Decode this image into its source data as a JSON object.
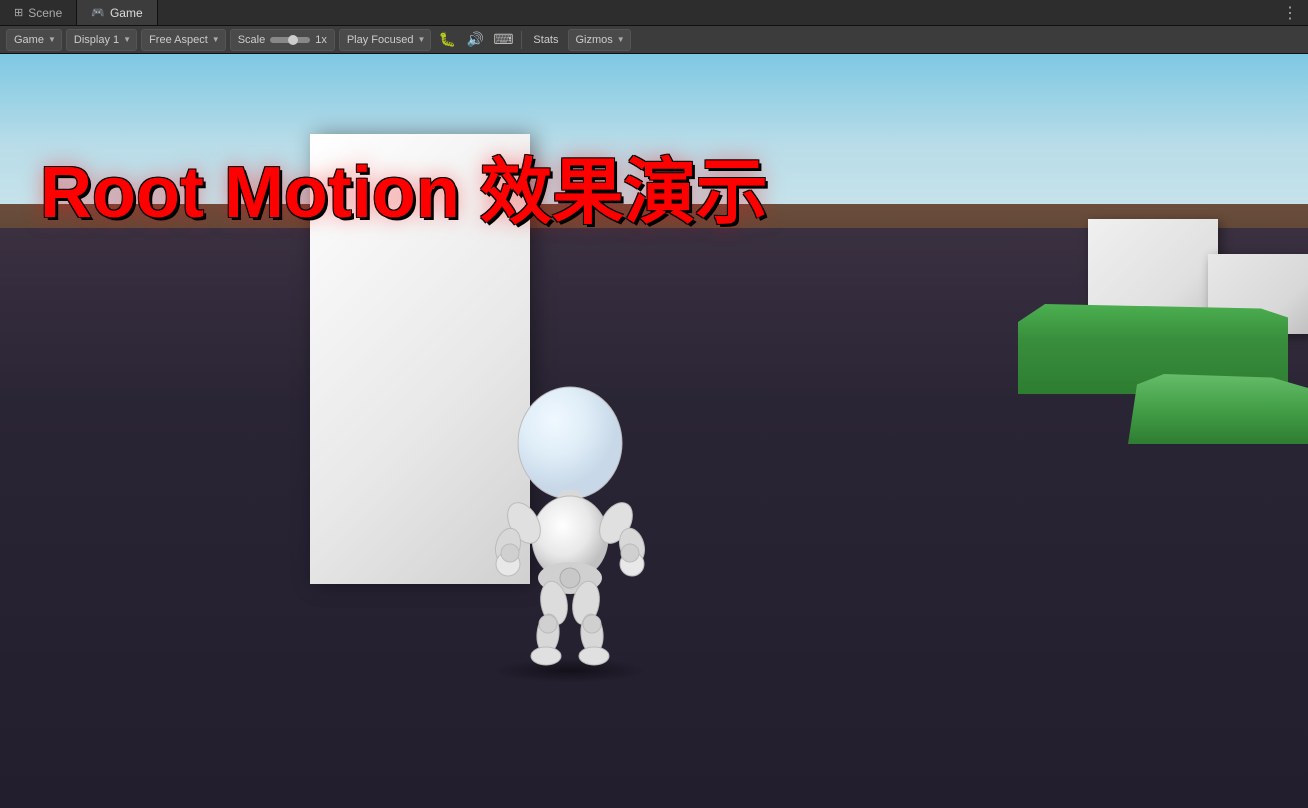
{
  "tabs": [
    {
      "id": "scene",
      "label": "Scene",
      "icon": "⊞",
      "active": false
    },
    {
      "id": "game",
      "label": "Game",
      "icon": "🎮",
      "active": true
    }
  ],
  "toolbar": {
    "game_label": "Game",
    "display_label": "Display 1",
    "aspect_label": "Free Aspect",
    "scale_label": "Scale",
    "scale_value": "1x",
    "play_focused_label": "Play Focused",
    "stats_label": "Stats",
    "gizmos_label": "Gizmos"
  },
  "viewport": {
    "title": "Root Motion 效果演示",
    "title_color": "#ff0000"
  },
  "more_icon": "⋮"
}
